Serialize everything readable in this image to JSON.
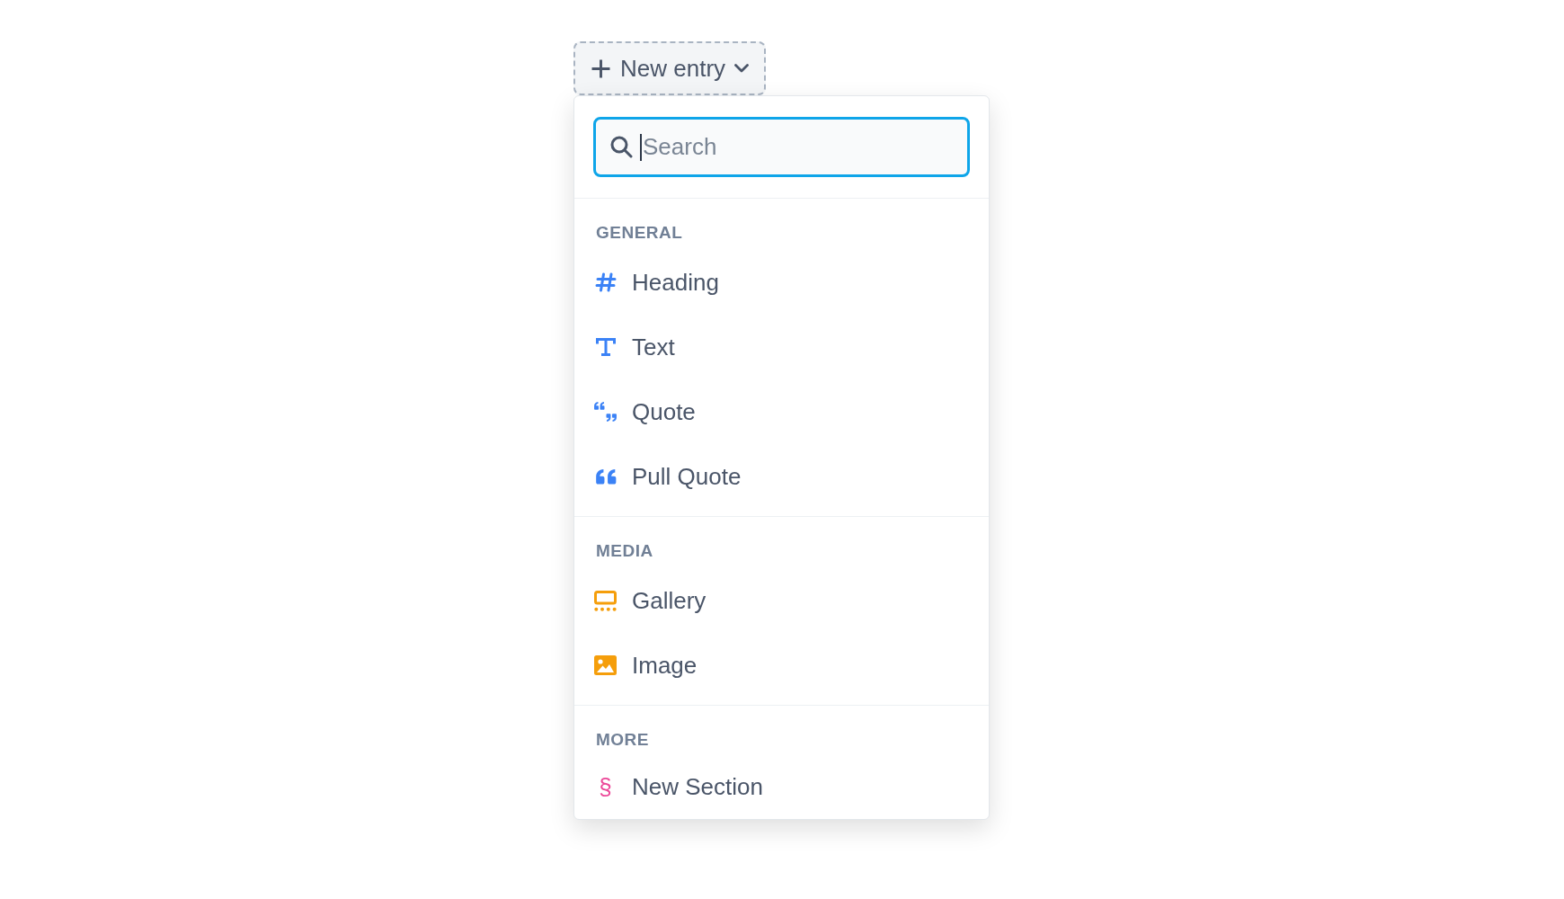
{
  "button": {
    "label": "New entry",
    "expanded": true
  },
  "search": {
    "placeholder": "Search",
    "focused": true
  },
  "groups": [
    {
      "title": "GENERAL",
      "items": [
        {
          "label": "Heading",
          "color": "#3b82f6"
        },
        {
          "label": "Text",
          "color": "#3b82f6"
        },
        {
          "label": "Quote",
          "color": "#3b82f6"
        },
        {
          "label": "Pull Quote",
          "color": "#3b82f6"
        }
      ]
    },
    {
      "title": "MEDIA",
      "items": [
        {
          "label": "Gallery",
          "color": "#f59e0b"
        },
        {
          "label": "Image",
          "color": "#f59e0b"
        }
      ]
    },
    {
      "title": "MORE",
      "items": [
        {
          "label": "New Section",
          "symbol": "§",
          "color": "#ec4899"
        }
      ]
    }
  ]
}
